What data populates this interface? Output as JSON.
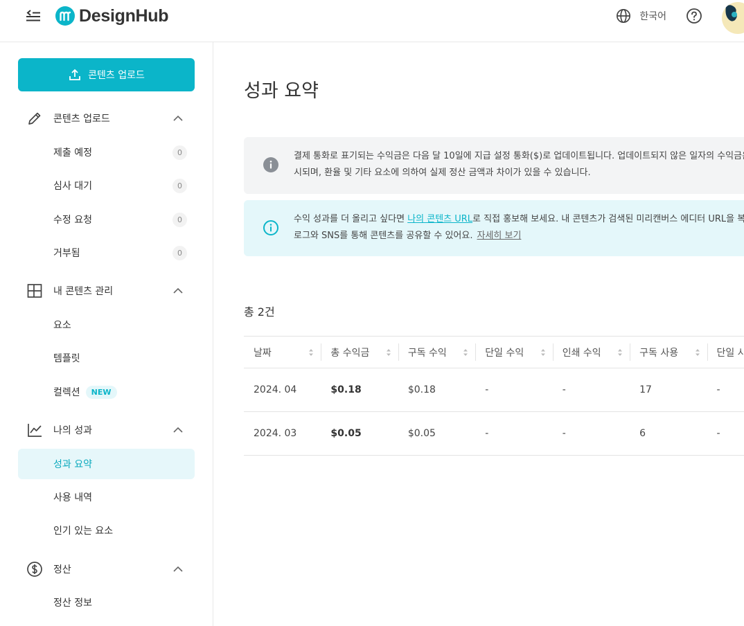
{
  "brand": {
    "name": "DesignHub",
    "accent": "#0bb5c9"
  },
  "topbar": {
    "menu_icon": "menu-collapse-icon",
    "language_label": "한국어",
    "language_icon": "globe-icon",
    "help_icon": "help-circle-icon"
  },
  "sidebar": {
    "upload_button_label": "콘텐츠 업로드",
    "groups": [
      {
        "label": "콘텐츠 업로드",
        "icon": "pencil-icon",
        "items": [
          {
            "label": "제출 예정",
            "count": "0"
          },
          {
            "label": "심사 대기",
            "count": "0"
          },
          {
            "label": "수정 요청",
            "count": "0"
          },
          {
            "label": "거부됨",
            "count": "0"
          }
        ]
      },
      {
        "label": "내 콘텐츠 관리",
        "icon": "grid-layout-icon",
        "items": [
          {
            "label": "요소"
          },
          {
            "label": "템플릿"
          },
          {
            "label": "컬렉션",
            "badge": "NEW"
          }
        ]
      },
      {
        "label": "나의 성과",
        "icon": "line-chart-icon",
        "items": [
          {
            "label": "성과 요약",
            "active": true
          },
          {
            "label": "사용 내역"
          },
          {
            "label": "인기 있는 요소"
          }
        ]
      },
      {
        "label": "정산",
        "icon": "dollar-circle-icon",
        "items": [
          {
            "label": "정산 정보"
          }
        ]
      }
    ]
  },
  "main": {
    "title": "성과 요약",
    "notice_currency": {
      "line1": "결제 통화로 표기되는 수익금은 다음 달 10일에 지급 설정 통화($)로 업데이트됩니다. 업데이트되지 않은 일자의 수익금은 예상 금액으로 참고해 주",
      "line2": "시되며, 환율 및 기타 요소에 의하여 실제 정산 금액과 차이가 있을 수 있습니다."
    },
    "notice_promo": {
      "line1_prefix": "수익 성과를 더 올리고 싶다면 ",
      "link": "나의 콘텐츠 URL",
      "line1_suffix": "로 직접 홍보해 보세요. 내 콘텐츠가 검색된 미리캔버스 에디터 URL을 복사해 블",
      "line2": "로그와 SNS를 통해 콘텐츠를 공유할 수 있어요.",
      "more": "자세히 보기"
    },
    "total_label": "총 2건",
    "table": {
      "columns": [
        "날짜",
        "총 수익금",
        "구독 수익",
        "단일 수익",
        "인쇄 수익",
        "구독 사용",
        "단일 사용"
      ],
      "rows": [
        [
          "2024. 04",
          "$0.18",
          "$0.18",
          "-",
          "-",
          "17",
          "-"
        ],
        [
          "2024. 03",
          "$0.05",
          "$0.05",
          "-",
          "-",
          "6",
          "-"
        ]
      ]
    }
  }
}
